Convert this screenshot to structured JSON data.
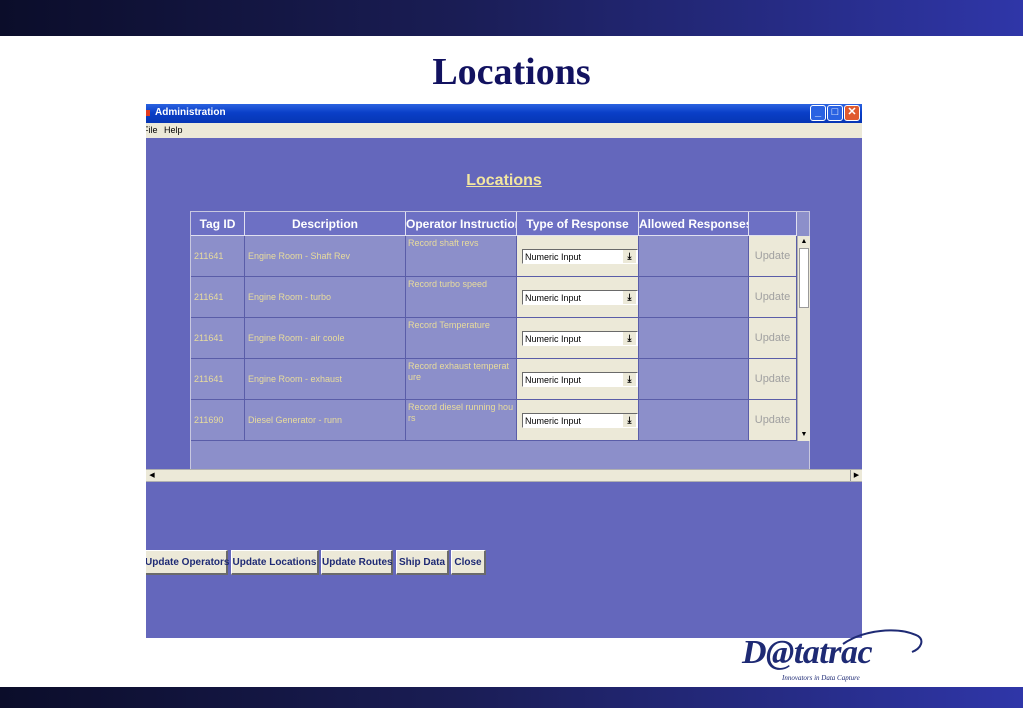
{
  "slide": {
    "title": "Locations"
  },
  "window": {
    "title": "Administration",
    "menu": [
      "File",
      "Help"
    ],
    "controls": {
      "minimize": "_",
      "maximize": "□",
      "close": "✕"
    }
  },
  "screen": {
    "heading": "Locations"
  },
  "table": {
    "columns": [
      "Tag ID",
      "Description",
      "Operator Instruction",
      "Type of Response",
      "Allowed Responses",
      ""
    ],
    "rows": [
      {
        "tag_id": "211641",
        "description": "Engine Room - Shaft Rev",
        "instruction": "Record shaft revs",
        "response": "Numeric Input",
        "allowed": "",
        "update": "Update"
      },
      {
        "tag_id": "211641",
        "description": "Engine Room - turbo",
        "instruction": "Record turbo speed",
        "response": "Numeric Input",
        "allowed": "",
        "update": "Update"
      },
      {
        "tag_id": "211641",
        "description": "Engine Room - air coole",
        "instruction": "Record Temperature",
        "response": "Numeric Input",
        "allowed": "",
        "update": "Update"
      },
      {
        "tag_id": "211641",
        "description": "Engine Room - exhaust",
        "instruction": "Record exhaust temperature",
        "response": "Numeric Input",
        "allowed": "",
        "update": "Update"
      },
      {
        "tag_id": "211690",
        "description": "Diesel Generator - runn",
        "instruction": "Record diesel running hours",
        "response": "Numeric Input",
        "allowed": "",
        "update": "Update"
      }
    ]
  },
  "buttons": {
    "update_operators": "Update Operators",
    "update_locations": "Update Locations",
    "update_routes": "Update Routes",
    "ship_data": "Ship Data",
    "close": "Close"
  },
  "logo": {
    "brand": "D@tatrac",
    "tagline": "Innovators in Data Capture"
  },
  "colors": {
    "window_bg": "#6467bc",
    "header_bg": "#6d70c4",
    "cell_text": "#e8dc9c",
    "button_text": "#1e2a74",
    "slide_title": "#121260"
  }
}
